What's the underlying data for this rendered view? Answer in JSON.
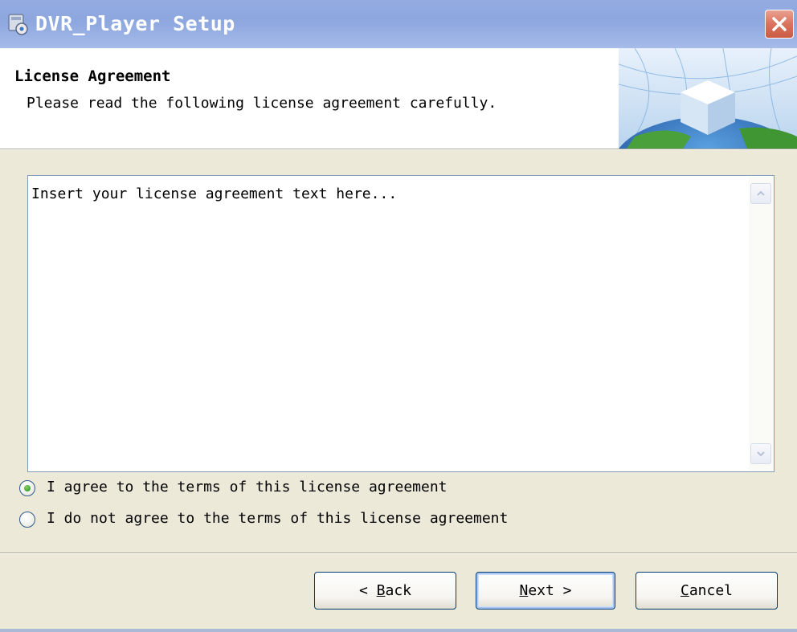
{
  "window": {
    "title": "DVR_Player Setup"
  },
  "banner": {
    "title": "License Agreement",
    "subtitle": "Please read the following license agreement carefully."
  },
  "license": {
    "text": "Insert your license agreement text here..."
  },
  "options": [
    {
      "label": "I agree to the terms of this license agreement",
      "selected": true
    },
    {
      "label": "I do not agree to the terms of this license agreement",
      "selected": false
    }
  ],
  "buttons": {
    "back": {
      "prefix": "< ",
      "mnemonic": "B",
      "rest": "ack"
    },
    "next": {
      "mnemonic": "N",
      "rest": "ext",
      "suffix": " >"
    },
    "cancel": {
      "mnemonic": "C",
      "rest": "ancel"
    }
  },
  "colors": {
    "title_bar": "#8da7df",
    "dialog_bg": "#ece9d8",
    "close_button": "#d9735d",
    "radio_selected": "#38a02e"
  },
  "icons": {
    "app": "installer-icon",
    "close": "close-icon",
    "banner": "globe-cube-graphic"
  }
}
